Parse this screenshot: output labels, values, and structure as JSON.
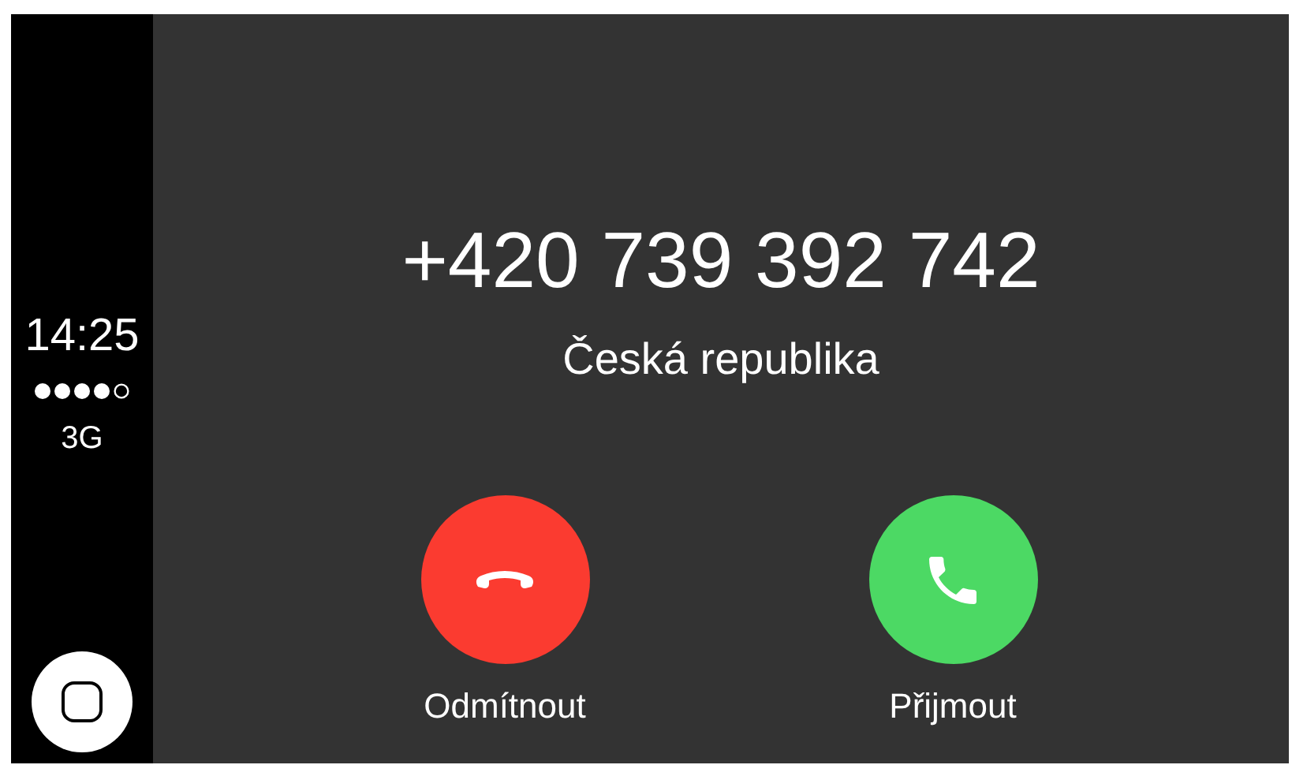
{
  "status": {
    "time": "14:25",
    "network": "3G"
  },
  "call": {
    "number": "+420 739 392 742",
    "country": "Česká republika"
  },
  "actions": [
    {
      "kind": "decline",
      "label": "Odmítnout"
    },
    {
      "kind": "accept",
      "label": "Přijmout"
    }
  ]
}
